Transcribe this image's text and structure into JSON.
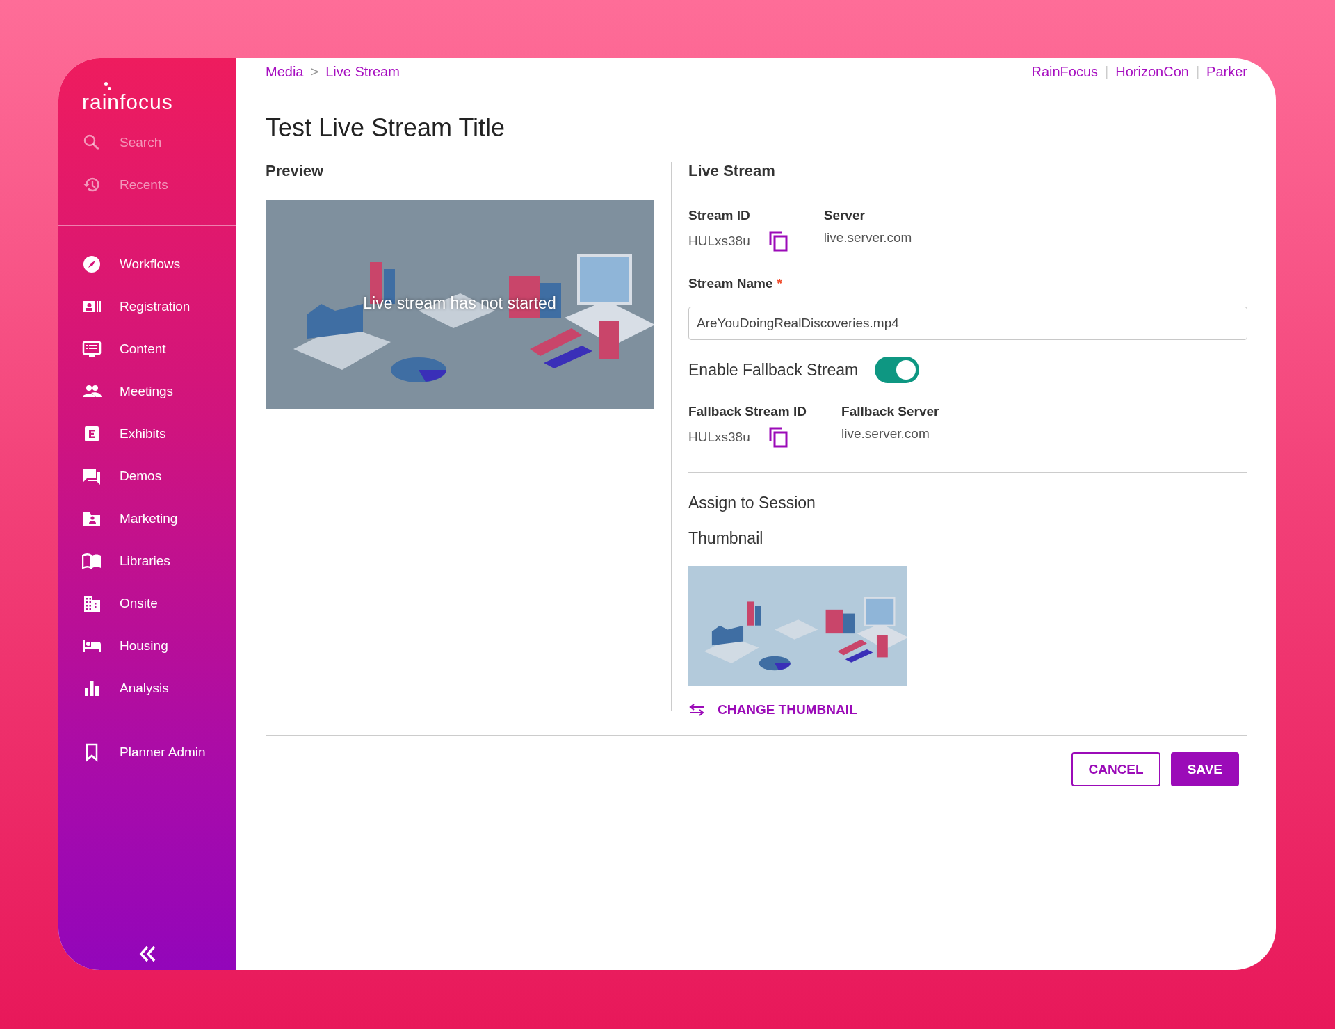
{
  "sidebar": {
    "logo": "rainfocus",
    "tools": [
      {
        "label": "Search"
      },
      {
        "label": "Recents"
      }
    ],
    "items": [
      {
        "label": "Workflows"
      },
      {
        "label": "Registration"
      },
      {
        "label": "Content"
      },
      {
        "label": "Meetings"
      },
      {
        "label": "Exhibits"
      },
      {
        "label": "Demos"
      },
      {
        "label": "Marketing"
      },
      {
        "label": "Libraries"
      },
      {
        "label": "Onsite"
      },
      {
        "label": "Housing"
      },
      {
        "label": "Analysis"
      }
    ],
    "footer_items": [
      {
        "label": "Planner Admin"
      }
    ]
  },
  "breadcrumb": [
    "Media",
    "Live Stream"
  ],
  "breadcrumb_separator": ">",
  "context_links": [
    "RainFocus",
    "HorizonCon",
    "Parker"
  ],
  "context_separator": "|",
  "title": "Test Live Stream Title",
  "preview": {
    "heading": "Preview",
    "overlay": "Live stream has not started"
  },
  "live_stream": {
    "heading": "Live Stream",
    "fields": [
      {
        "label": "Stream ID",
        "value": "HULxs38u",
        "copyable": true
      },
      {
        "label": "Server",
        "value": "live.server.com",
        "copyable": false
      }
    ],
    "stream_name": {
      "label": "Stream Name",
      "required_mark": "*",
      "value": "AreYouDoingRealDiscoveries.mp4"
    },
    "fallback_toggle": {
      "label": "Enable Fallback Stream",
      "on": true
    },
    "fallback_fields": [
      {
        "label": "Fallback Stream ID",
        "value": "HULxs38u",
        "copyable": true
      },
      {
        "label": "Fallback Server",
        "value": "live.server.com",
        "copyable": false
      }
    ],
    "assign_heading": "Assign to Session",
    "thumbnail_heading": "Thumbnail",
    "change_thumbnail": "CHANGE THUMBNAIL"
  },
  "buttons": [
    {
      "label": "CANCEL",
      "kind": "secondary"
    },
    {
      "label": "SAVE",
      "kind": "primary"
    }
  ]
}
